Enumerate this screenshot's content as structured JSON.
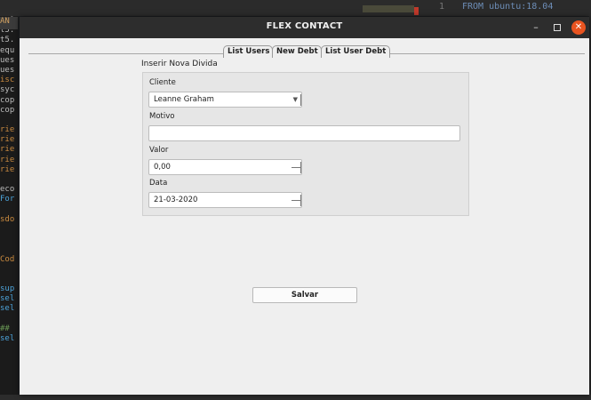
{
  "background": {
    "editor_line_number": "1",
    "editor_code": "FROM ubuntu:18.04",
    "left_corner": "AN",
    "left_lines": [
      "x_1",
      "t5.",
      "t5.",
      "equ",
      "ues",
      "ues",
      "isc",
      "syc",
      "cop",
      "cop",
      "",
      "rie",
      "rie",
      "rie",
      "rie",
      "rie",
      "",
      "eco",
      "For",
      "",
      "sdo",
      "",
      "",
      "",
      "Cod",
      "",
      "",
      "sup",
      "sel",
      "sel",
      "",
      "##",
      "sel"
    ]
  },
  "window": {
    "title": "FLEX CONTACT",
    "controls": {
      "minimize": "–",
      "close": "✕"
    }
  },
  "tabs": [
    "List Users",
    "New Debt",
    "List User Debt"
  ],
  "form": {
    "heading": "Inserir Nova Divida",
    "cliente_label": "Cliente",
    "cliente_value": "Leanne Graham",
    "motivo_label": "Motivo",
    "motivo_value": "",
    "valor_label": "Valor",
    "valor_value": "0,00",
    "data_label": "Data",
    "data_value": "21-03-2020",
    "save_label": "Salvar"
  },
  "colors": {
    "titlebar": "#2d2d2d",
    "close_button": "#e95420",
    "window_bg": "#efefef"
  }
}
